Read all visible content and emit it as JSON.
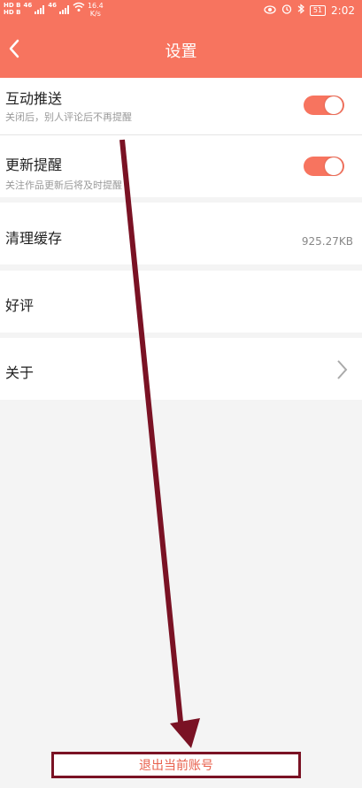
{
  "status_bar": {
    "hd1": "HD B",
    "hd2": "HD B",
    "net1": "46",
    "net2": "46",
    "speed_value": "16.4",
    "speed_unit": "K/s",
    "battery": "51",
    "time": "2:02"
  },
  "header": {
    "title": "设置"
  },
  "settings": {
    "interaction_push": {
      "label": "互动推送",
      "description": "关闭后，别人评论后不再提醒",
      "enabled": true
    },
    "update_reminder": {
      "label": "更新提醒",
      "description": "关注作品更新后将及时提醒",
      "enabled": true
    },
    "clear_cache": {
      "label": "清理缓存",
      "value": "925.27KB"
    },
    "rate": {
      "label": "好评"
    },
    "about": {
      "label": "关于"
    }
  },
  "logout": {
    "label": "退出当前账号"
  },
  "colors": {
    "accent": "#f7745f",
    "annotation": "#7a1224"
  }
}
